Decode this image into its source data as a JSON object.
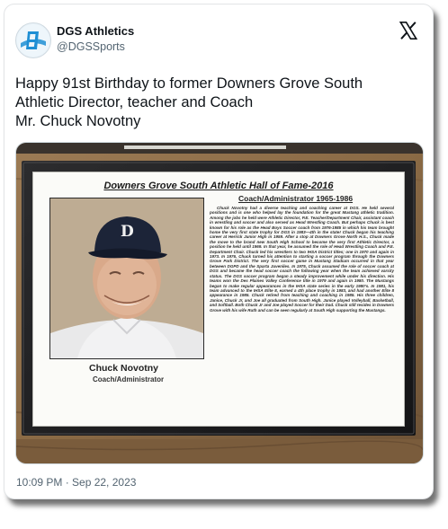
{
  "account": {
    "display_name": "DGS Athletics",
    "handle": "@DGSSports"
  },
  "tweet": {
    "lines": [
      "Happy 91st Birthday to former Downers Grove South",
      "Athletic Director, teacher and Coach",
      "Mr. Chuck Novotny"
    ],
    "timestamp": "10:09 PM · Sep 22, 2023"
  },
  "plaque": {
    "title": "Downers Grove South Athletic Hall of Fame-2016",
    "role_heading": "Coach/Administrator 1965-1986",
    "name": "Chuck Novotny",
    "role": "Coach/Administrator",
    "cap_letter": "D",
    "bio": "Chuck Novotny had a diverse teaching and coaching career at DGS. He held several positions and is one who helped lay the foundation for the great Mustang athletic tradition. Among the jobs he held were Athletic Director, P.E. Teacher/Department Chair, assistant coach in wrestling and soccer and also served as Head Wrestling Coach. But perhaps Chuck is best known for his role as the Head Boys Soccer coach from 1976-1985 in which his team brought home the very first state trophy for DGS in 1983—4th in the state! Chuck began his teaching career at Herrick Junior High in 1959. After a stop at Downers Grove North H.S., Chuck made the move to the brand new South High School to become the very first Athletic Director, a position he held until 1969. In that year, he assumed the role of Head Wrestling Coach and P.E. Department Chair. Chuck led his wrestlers to two IHSA District titles; one in 1970 and again in 1973. In 1976, Chuck turned his attention to starting a soccer program through the Downers Grove Park District. The very first soccer game in Mustang Stadium occurred in that year between DGPD and the Sparta Juveniles. In 1975, Chuck assumed the role of soccer coach at DGS and became the head soccer coach the following year when the team achieved varsity status. The DGS soccer program began a steady improvement while under his direction. His teams won the Des Plaines Valley Conference title in 1979 and again in 1980. The Mustangs began to make regular appearances in the IHSA state series in the early 1980's. In 1981, his team advanced to the IHSA Elite 8, earned a 4th place trophy in 1983, and had another Elite 8 appearance in 1985. Chuck retired from teaching and coaching in 1985. His three children, Janice, Chuck Jr, and Joe all graduated from South High. Janice played Volleyball, Basketball, and Softball. Both Chuck Jr and Joe played Soccer for their Dad. Chuck still resides in Downers Grove with his wife Ruth and can be seen regularly at South High supporting the Mustangs."
  },
  "colors": {
    "text_primary": "#0f1419",
    "text_secondary": "#536471",
    "brand_blue": "#1f8fd4",
    "wood": "#8a6a45",
    "cap_navy": "#1c2438"
  },
  "icons": {
    "close": "x-logo-icon",
    "avatar": "dgs-logo"
  }
}
